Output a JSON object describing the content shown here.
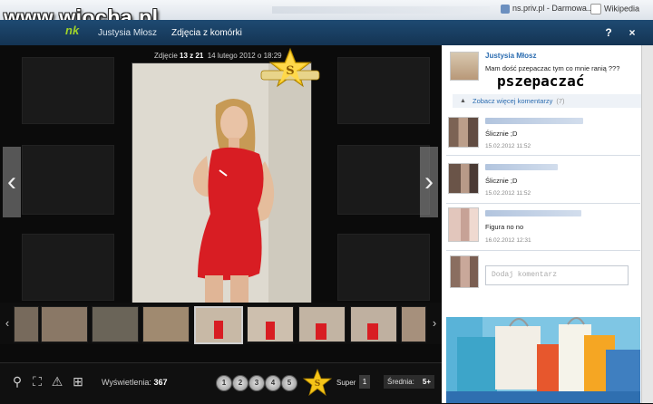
{
  "browser": {
    "watermark": "www.wiocha.pl",
    "bookmarks": [
      "ns.priv.pl - Darmowa...",
      "Wikipedia"
    ]
  },
  "viewer": {
    "logo": "nk",
    "owner": "Justysia Młosz",
    "album_title": "Zdjęcia z komórki",
    "help_label": "?",
    "close_label": "×",
    "photo_prefix": "Zdjęcie",
    "photo_index": "13 z 21",
    "photo_date": "14 lutego 2012 o 18:29"
  },
  "stats": {
    "views_label": "Wyświetlenia:",
    "views_value": "367",
    "ratings": [
      "1",
      "2",
      "3",
      "4",
      "5"
    ],
    "super_label": "Super",
    "super_count": "1",
    "avg_label": "Średnia:",
    "avg_value": "5+"
  },
  "sidebar": {
    "author_name": "Justysia Młosz",
    "author_text": "Mam dość pzepaczac tym co mnie ranią ???",
    "annotation": "pszepaczać",
    "more_label": "Zobacz więcej komentarzy",
    "more_count": "(7)",
    "comments": [
      {
        "text": "Ślicznie ;D",
        "date": "15.02.2012 11:52"
      },
      {
        "text": "Ślicznie ;D",
        "date": "15.02.2012 11:52"
      },
      {
        "text": "Figura no no",
        "date": "16.02.2012 12:31"
      }
    ],
    "comment_placeholder": "Dodaj komentarz"
  },
  "icons": {
    "zoom": "zoom-icon",
    "fullscreen": "fullscreen-icon",
    "report": "warning-icon",
    "add_photo": "add-photo-icon",
    "star": "star-icon"
  },
  "colors": {
    "topbar": "#1e4a72",
    "accent_link": "#2b6cb0",
    "logo_green": "#9fd12a",
    "dress_red": "#d81d23"
  }
}
